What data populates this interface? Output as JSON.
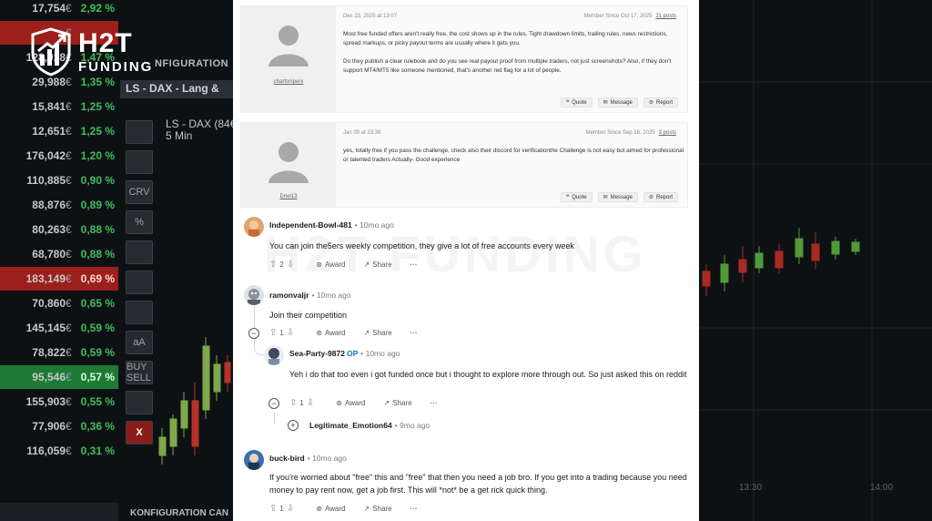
{
  "logo": {
    "line1": "H2T",
    "line2": "FUNDING",
    "accent": "#ffffff"
  },
  "background": {
    "tickers": [
      {
        "price": "17,754",
        "pct": "2,92 %",
        "state": "normal"
      },
      {
        "price": "",
        "pct": "",
        "state": "red"
      },
      {
        "price": "128,918",
        "pct": "1,47 %",
        "state": "normal"
      },
      {
        "price": "29,988",
        "pct": "1,35 %",
        "state": "normal"
      },
      {
        "price": "15,841",
        "pct": "1,25 %",
        "state": "normal"
      },
      {
        "price": "12,651",
        "pct": "1,25 %",
        "state": "normal"
      },
      {
        "price": "176,042",
        "pct": "1,20 %",
        "state": "normal"
      },
      {
        "price": "110,885",
        "pct": "0,90 %",
        "state": "normal"
      },
      {
        "price": "88,876",
        "pct": "0,89 %",
        "state": "normal"
      },
      {
        "price": "80,263",
        "pct": "0,88 %",
        "state": "normal"
      },
      {
        "price": "68,780",
        "pct": "0,88 %",
        "state": "normal"
      },
      {
        "price": "183,149",
        "pct": "0,69 %",
        "state": "red"
      },
      {
        "price": "70,860",
        "pct": "0,65 %",
        "state": "normal"
      },
      {
        "price": "145,145",
        "pct": "0,59 %",
        "state": "normal"
      },
      {
        "price": "78,822",
        "pct": "0,59 %",
        "state": "normal"
      },
      {
        "price": "95,546",
        "pct": "0,57 %",
        "state": "green"
      },
      {
        "price": "155,903",
        "pct": "0,55 %",
        "state": "normal"
      },
      {
        "price": "77,906",
        "pct": "0,36 %",
        "state": "normal"
      },
      {
        "price": "116,059",
        "pct": "0,31 %",
        "state": "normal"
      }
    ],
    "currency": "€",
    "konfig_top": "NFIGURATION",
    "panel_head": "LS - DAX - Lang &",
    "panel_title_1": "LS - DAX (84€",
    "panel_title_2": "5 Min",
    "konfig_bottom": "KONFIGURATION   CAN",
    "tool_labels": [
      "",
      "",
      "CRV",
      "%",
      "",
      "",
      "",
      "aA",
      "BUY SELL",
      "",
      "X"
    ],
    "right_times": [
      "13:30",
      "14:00"
    ]
  },
  "forum": [
    {
      "user": "chartsniperx",
      "date": "Dec 23, 2025 at 13:07",
      "member": "Member Since Oct 17, 2025",
      "posts": "21 posts",
      "body": [
        "Most free funded offers aren't really free, the cost shows up in the rules. Tight drawdown limits, trailing rules, news restrictions, spread markups, or picky payout terms are usually where it gets you.",
        "Do they publish a clear rulebook and do you see real payout proof from multiple traders, not just screenshots? Also, if they don't support MT4/MT5 like someone mentioned, that's another red flag for a lot of people."
      ],
      "actions": [
        "Quote",
        "Message",
        "Report"
      ]
    },
    {
      "user": "Driel13",
      "date": "Jan 09 at 23:38",
      "member": "Member Since Sep 16, 2025",
      "posts": "3 posts",
      "body": [
        "yes, totally free if you pass the challenge, check also their discord for verificationthe Challenge is not easy but aimed for professional or talented traders Actually- Good experience"
      ],
      "actions": [
        "Quote",
        "Message",
        "Report"
      ]
    }
  ],
  "comments": [
    {
      "user": "Independent-Bowl-481",
      "op": "",
      "age": "10mo ago",
      "text": "You can join the5ers weekly competition, they give a lot of free accounts every week",
      "votes": "2",
      "award": "Award",
      "share": "Share",
      "more": "···"
    },
    {
      "user": "ramonvaljr",
      "op": "",
      "age": "10mo ago",
      "text": "Join their competition",
      "votes": "1",
      "award": "Award",
      "share": "Share",
      "more": "···"
    },
    {
      "user": "Sea-Party-9872",
      "op": "OP",
      "age": "10mo ago",
      "text": "Yeh i do that too even i got funded once but i thought to explore more through out. So just asked this on reddit",
      "votes": "1",
      "award": "Award",
      "share": "Share",
      "more": "···"
    },
    {
      "user": "Legitimate_Emotion64",
      "op": "",
      "age": "9mo ago",
      "text": "",
      "votes": "",
      "award": "",
      "share": "",
      "more": ""
    },
    {
      "user": "buck-bird",
      "op": "",
      "age": "10mo ago",
      "text": "If you're worried about \"free\" this and \"free\" that then you need a job bro. If you get into a trading because you need money to pay rent now, get a job first. This will *not* be a get rick quick thing.",
      "votes": "1",
      "award": "Award",
      "share": "Share",
      "more": "···"
    }
  ],
  "watermark": "H2T FUNDING",
  "colors": {
    "op_badge": "#0079d3",
    "ticker_green": "#3fbf5c",
    "ticker_red": "#9c1f1b"
  }
}
